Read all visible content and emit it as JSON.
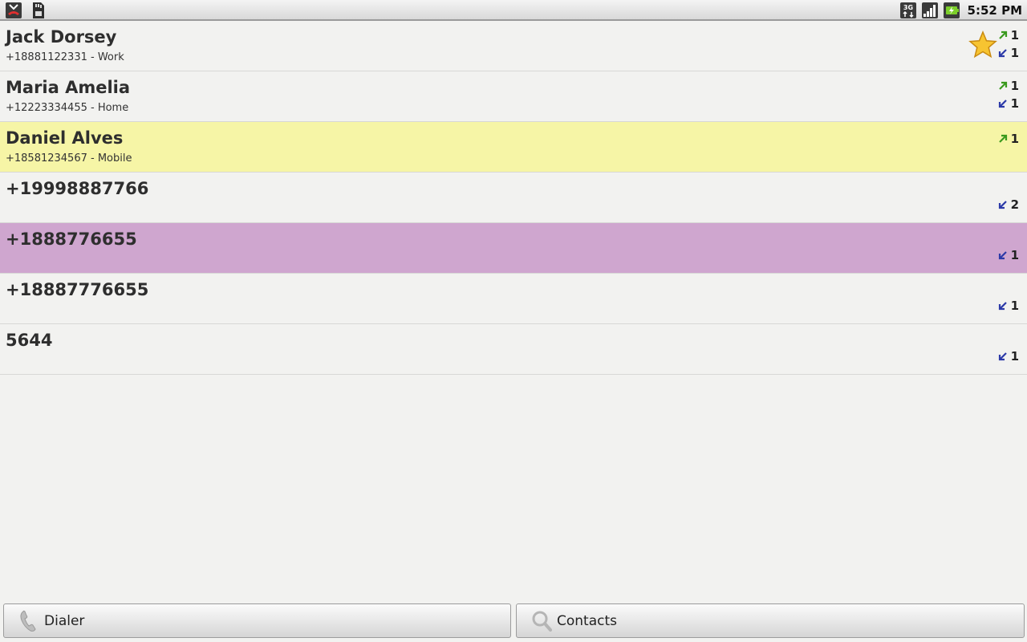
{
  "status_bar": {
    "left_icons": [
      "missed-call-icon",
      "sd-card-icon"
    ],
    "right_icons": [
      "3g-data-icon",
      "signal-strength-icon",
      "battery-charging-icon"
    ],
    "time": "5:52 PM"
  },
  "call_log": [
    {
      "name": "Jack Dorsey",
      "number_label": "+18881122331 - Work",
      "starred": true,
      "highlight": "none",
      "outgoing_count": "1",
      "incoming_count": "1"
    },
    {
      "name": "Maria Amelia",
      "number_label": "+12223334455 - Home",
      "starred": false,
      "highlight": "none",
      "outgoing_count": "1",
      "incoming_count": "1"
    },
    {
      "name": "Daniel Alves",
      "number_label": "+18581234567 - Mobile",
      "starred": false,
      "highlight": "yellow",
      "outgoing_count": "1"
    },
    {
      "name": "+19998887766",
      "starred": false,
      "highlight": "none",
      "incoming_count": "2"
    },
    {
      "name": "+1888776655",
      "starred": false,
      "highlight": "purple",
      "incoming_count": "1"
    },
    {
      "name": "+18887776655",
      "starred": false,
      "highlight": "none",
      "incoming_count": "1"
    },
    {
      "name": "5644",
      "starred": false,
      "highlight": "none",
      "incoming_count": "1"
    }
  ],
  "buttons": {
    "dialer": {
      "label": "Dialer",
      "icon": "phone-handset-icon"
    },
    "contacts": {
      "label": "Contacts",
      "icon": "search-icon"
    }
  },
  "colors": {
    "outgoing_arrow": "#3a9a1e",
    "incoming_arrow": "#2c3aa8",
    "highlight_yellow": "#f6f5a6",
    "highlight_purple": "#cfa6cf"
  }
}
